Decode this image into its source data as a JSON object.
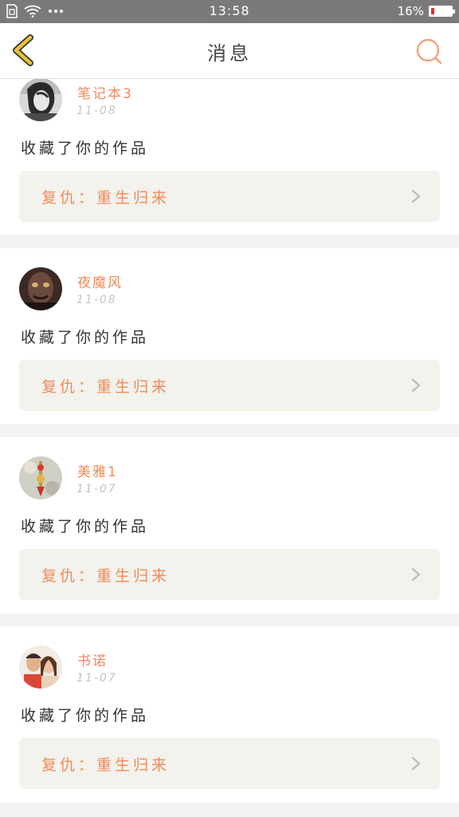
{
  "status": {
    "time": "13:58",
    "battery_text": "16%",
    "battery_level": 0.16
  },
  "nav": {
    "title": "消息"
  },
  "notifications": [
    {
      "username": "笔记本3",
      "date": "11-08",
      "action": "收藏了你的作品",
      "work_title": "复仇：重生归来"
    },
    {
      "username": "夜魔风",
      "date": "11-08",
      "action": "收藏了你的作品",
      "work_title": "复仇：重生归来"
    },
    {
      "username": "美雅1",
      "date": "11-07",
      "action": "收藏了你的作品",
      "work_title": "复仇：重生归来"
    },
    {
      "username": "书诺",
      "date": "11-07",
      "action": "收藏了你的作品",
      "work_title": "复仇：重生归来"
    }
  ],
  "colors": {
    "accent": "#f08a5a",
    "back_arrow": "#e8c33a",
    "status_bar": "#7a7a7a",
    "battery_low": "#e52d2d"
  },
  "icons": [
    "sim-icon",
    "wifi-icon",
    "more-dots-icon",
    "battery-icon",
    "back-arrow-icon",
    "search-icon",
    "chevron-right-icon"
  ]
}
